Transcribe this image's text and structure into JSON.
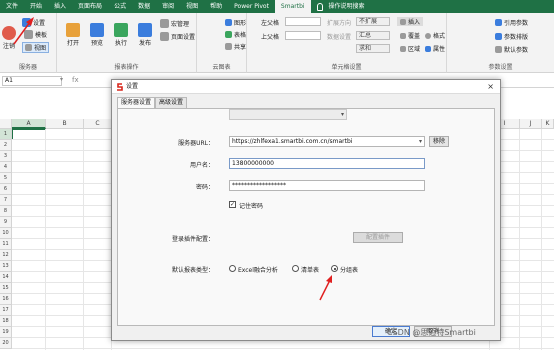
{
  "menubar": {
    "tabs": [
      "文件",
      "开始",
      "插入",
      "页面布局",
      "公式",
      "数据",
      "审阅",
      "视图",
      "帮助",
      "Power Pivot",
      "Smartbi"
    ],
    "active": "Smartbi",
    "tell_me": "操作说明搜索"
  },
  "ribbon": {
    "server_group": {
      "name": "服务器",
      "logout": "注销",
      "settings": "设置",
      "template": "模板",
      "view": "视图"
    },
    "report_group": {
      "name": "报表操作",
      "open": "打开",
      "preview": "预览",
      "execute": "执行",
      "publish": "发布",
      "macro_manage": "宏管理",
      "page_setup": "页面设置"
    },
    "cloud_group": {
      "name": "云图表",
      "chart": "图形",
      "table": "表格",
      "share": "共享"
    },
    "cell_group": {
      "name": "单元格设置",
      "left_parent": "左父格",
      "up_parent": "上父格",
      "expand_dir": "扩展方向",
      "data_setting": "数据设置",
      "no_expand": "不扩展",
      "summary": "汇总",
      "sum": "求和",
      "insert": "插入",
      "overwrite": "覆盖",
      "region": "区域",
      "style": "格式",
      "property": "属性"
    },
    "param_group": {
      "name": "参数设置",
      "ref_param": "引用参数",
      "param_sort": "参数排版",
      "default_param": "默认参数"
    }
  },
  "formula_bar": {
    "name_box": "A1",
    "fx": "fx"
  },
  "grid": {
    "columns": [
      "A",
      "B",
      "C",
      "I",
      "J",
      "K"
    ],
    "rows": [
      "1",
      "2",
      "3",
      "4",
      "5",
      "6",
      "7",
      "8",
      "9",
      "10",
      "11",
      "12",
      "13",
      "14",
      "15",
      "16",
      "17",
      "18",
      "19",
      "20"
    ]
  },
  "dialog": {
    "title": "设置",
    "tabs": [
      "服务器设置",
      "高级设置"
    ],
    "server_url_label": "服务器URL：",
    "server_url_value": "https://zhlfexa1.smartbi.com.cn/smartbi",
    "remove_button": "移除",
    "username_label": "用户名：",
    "username_value": "13800000000",
    "password_label": "密码：",
    "password_value": "******************",
    "remember_password": "记住密码",
    "login_plugin_label": "登录插件配置：",
    "config_plugin_button": "配置插件",
    "default_report_label": "默认报表类型：",
    "report_types": [
      "Excel融合分析",
      "清单表",
      "分组表"
    ],
    "selected_report_type": "分组表",
    "ok_button": "确定",
    "cancel_button": "取消"
  },
  "watermark": "CSDN @思迈特Smartbi"
}
